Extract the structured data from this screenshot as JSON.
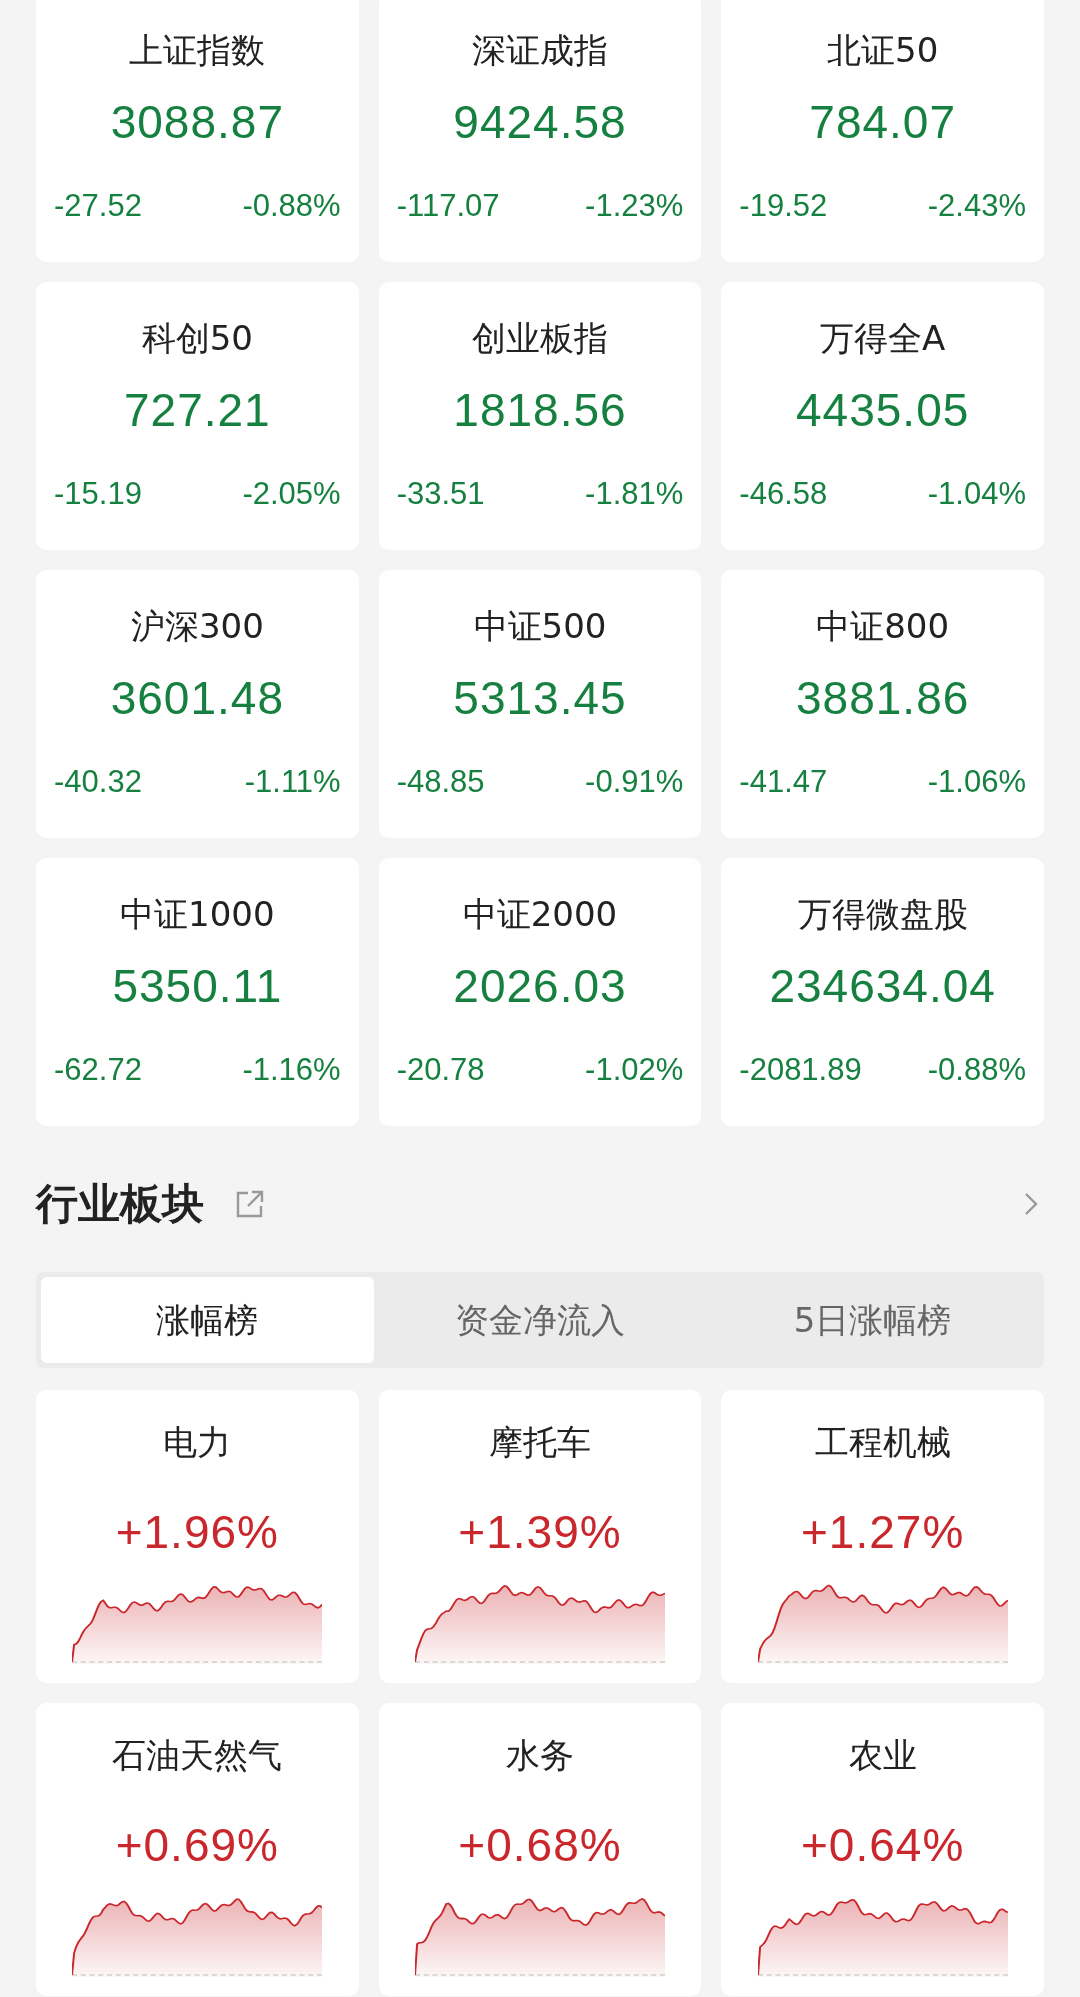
{
  "indices": [
    {
      "name": "上证指数",
      "value": "3088.87",
      "change": "-27.52",
      "pct": "-0.88%"
    },
    {
      "name": "深证成指",
      "value": "9424.58",
      "change": "-117.07",
      "pct": "-1.23%"
    },
    {
      "name": "北证50",
      "value": "784.07",
      "change": "-19.52",
      "pct": "-2.43%"
    },
    {
      "name": "科创50",
      "value": "727.21",
      "change": "-15.19",
      "pct": "-2.05%"
    },
    {
      "name": "创业板指",
      "value": "1818.56",
      "change": "-33.51",
      "pct": "-1.81%"
    },
    {
      "name": "万得全A",
      "value": "4435.05",
      "change": "-46.58",
      "pct": "-1.04%"
    },
    {
      "name": "沪深300",
      "value": "3601.48",
      "change": "-40.32",
      "pct": "-1.11%"
    },
    {
      "name": "中证500",
      "value": "5313.45",
      "change": "-48.85",
      "pct": "-0.91%"
    },
    {
      "name": "中证800",
      "value": "3881.86",
      "change": "-41.47",
      "pct": "-1.06%"
    },
    {
      "name": "中证1000",
      "value": "5350.11",
      "change": "-62.72",
      "pct": "-1.16%"
    },
    {
      "name": "中证2000",
      "value": "2026.03",
      "change": "-20.78",
      "pct": "-1.02%"
    },
    {
      "name": "万得微盘股",
      "value": "234634.04",
      "change": "-2081.89",
      "pct": "-0.88%"
    }
  ],
  "section": {
    "title": "行业板块"
  },
  "tabs": [
    {
      "label": "涨幅榜",
      "selected": true
    },
    {
      "label": "资金净流入",
      "selected": false
    },
    {
      "label": "5日涨幅榜",
      "selected": false
    }
  ],
  "sectors": [
    {
      "name": "电力",
      "pct": "+1.96%"
    },
    {
      "name": "摩托车",
      "pct": "+1.39%"
    },
    {
      "name": "工程机械",
      "pct": "+1.27%"
    },
    {
      "name": "石油天然气",
      "pct": "+0.69%"
    },
    {
      "name": "水务",
      "pct": "+0.68%"
    },
    {
      "name": "农业",
      "pct": "+0.64%"
    }
  ]
}
